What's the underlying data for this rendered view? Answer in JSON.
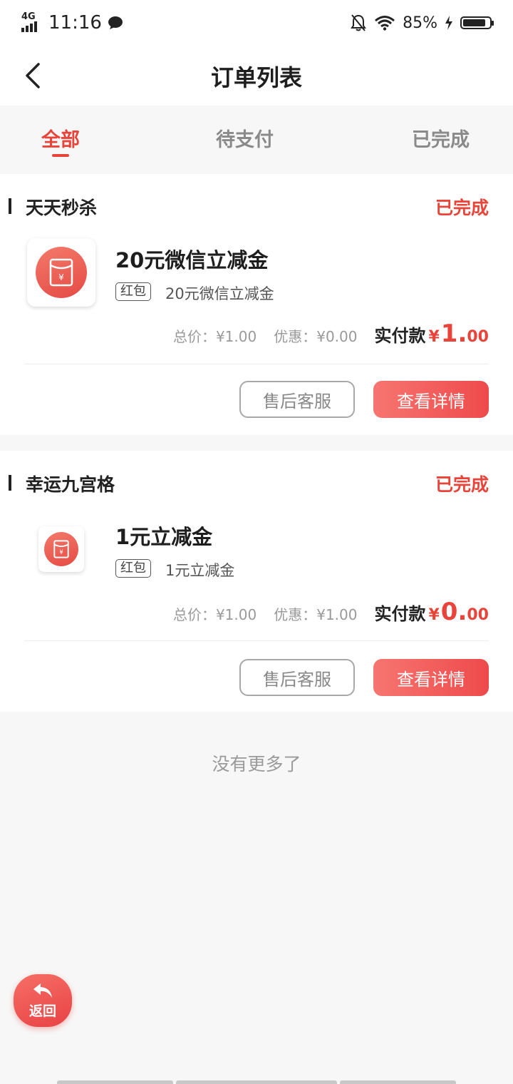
{
  "status_bar": {
    "network": "4G",
    "time": "11:16",
    "battery_pct": "85%",
    "battery_level": 0.85,
    "icons": [
      "signal-icon",
      "message-icon",
      "mute-bell-icon",
      "wifi-icon",
      "charging-icon",
      "battery-icon"
    ]
  },
  "nav": {
    "title": "订单列表",
    "back_icon": "chevron-left-icon"
  },
  "tabs": [
    {
      "label": "全部",
      "active": true
    },
    {
      "label": "待支付",
      "active": false
    },
    {
      "label": "已完成",
      "active": false
    }
  ],
  "orders": [
    {
      "store": "天天秒杀",
      "status": "已完成",
      "title": "20元微信立减金",
      "tag": "红包",
      "subtitle": "20元微信立减金",
      "total_label": "总价：¥1.00",
      "discount_label": "优惠：¥0.00",
      "pay_label": "实付款",
      "yen": "¥",
      "pay_int": "1.",
      "pay_dec": "00",
      "btn_service": "售后客服",
      "btn_detail": "查看详情"
    },
    {
      "store": "幸运九宫格",
      "status": "已完成",
      "title": "1元立减金",
      "tag": "红包",
      "subtitle": "1元立减金",
      "total_label": "总价：¥1.00",
      "discount_label": "优惠：¥1.00",
      "pay_label": "实付款",
      "yen": "¥",
      "pay_int": "0.",
      "pay_dec": "00",
      "btn_service": "售后客服",
      "btn_detail": "查看详情"
    }
  ],
  "footer": {
    "no_more": "没有更多了"
  },
  "float_button": {
    "label": "返回",
    "icon": "reply-arrow-icon"
  },
  "colors": {
    "accent": "#e8443a",
    "button_gradient_start": "#f77570",
    "button_gradient_end": "#ee4a4b"
  }
}
